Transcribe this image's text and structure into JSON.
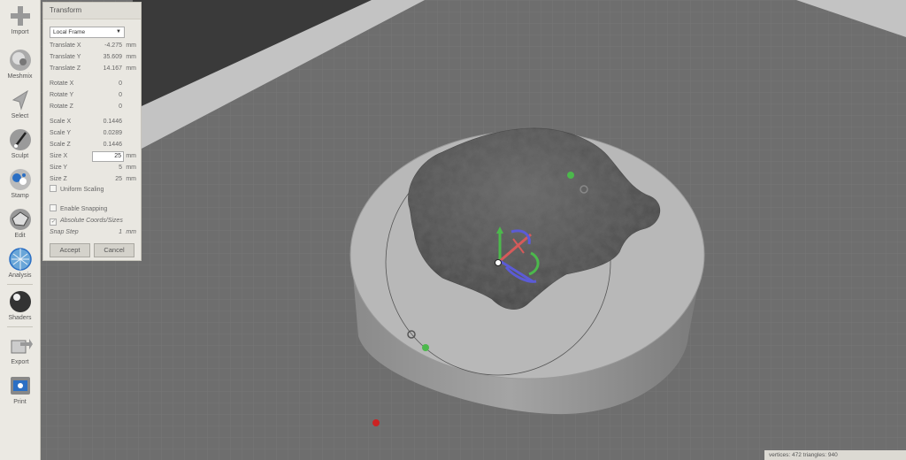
{
  "toolbar": {
    "items": [
      {
        "label": "Import",
        "icon": "plus-icon"
      },
      {
        "label": "Meshmix",
        "icon": "meshmix-icon"
      },
      {
        "label": "Select",
        "icon": "select-arrow-icon"
      },
      {
        "label": "Sculpt",
        "icon": "brush-icon"
      },
      {
        "label": "Stamp",
        "icon": "stamp-icon"
      },
      {
        "label": "Edit",
        "icon": "edit-icon"
      },
      {
        "label": "Analysis",
        "icon": "analysis-icon"
      },
      {
        "label": "Shaders",
        "icon": "shaders-icon"
      },
      {
        "label": "Export",
        "icon": "export-icon"
      },
      {
        "label": "Print",
        "icon": "print-icon"
      }
    ]
  },
  "panel": {
    "title": "Transform",
    "frame": "Local Frame",
    "translate_x": {
      "label": "Translate X",
      "value": "-4.275",
      "unit": "mm"
    },
    "translate_y": {
      "label": "Translate Y",
      "value": "35.609",
      "unit": "mm"
    },
    "translate_z": {
      "label": "Translate Z",
      "value": "14.167",
      "unit": "mm"
    },
    "rotate_x": {
      "label": "Rotate X",
      "value": "0"
    },
    "rotate_y": {
      "label": "Rotate Y",
      "value": "0"
    },
    "rotate_z": {
      "label": "Rotate Z",
      "value": "0"
    },
    "scale_x": {
      "label": "Scale X",
      "value": "0.1446"
    },
    "scale_y": {
      "label": "Scale Y",
      "value": "0.0289"
    },
    "scale_z": {
      "label": "Scale Z",
      "value": "0.1446"
    },
    "size_x": {
      "label": "Size X",
      "value": "25",
      "unit": "mm"
    },
    "size_y": {
      "label": "Size Y",
      "value": "5",
      "unit": "mm"
    },
    "size_z": {
      "label": "Size Z",
      "value": "25",
      "unit": "mm"
    },
    "uniform_scaling": "Uniform Scaling",
    "enable_snapping": "Enable Snapping",
    "absolute_coords": "Absolute Coords/Sizes",
    "snap_step": {
      "label": "Snap Step",
      "value": "1",
      "unit": "mm"
    },
    "accept": "Accept",
    "cancel": "Cancel"
  },
  "status": "vertices: 472 triangles: 940",
  "colors": {
    "toolbar_bg": "#ebe9e3",
    "floor": "#6b6b6b",
    "mesh": "#4f4f4f",
    "base": "#b9b9b9",
    "gizmo_red": "#d55a5a",
    "gizmo_green": "#4cb84c",
    "gizmo_blue": "#5b5bd6"
  }
}
